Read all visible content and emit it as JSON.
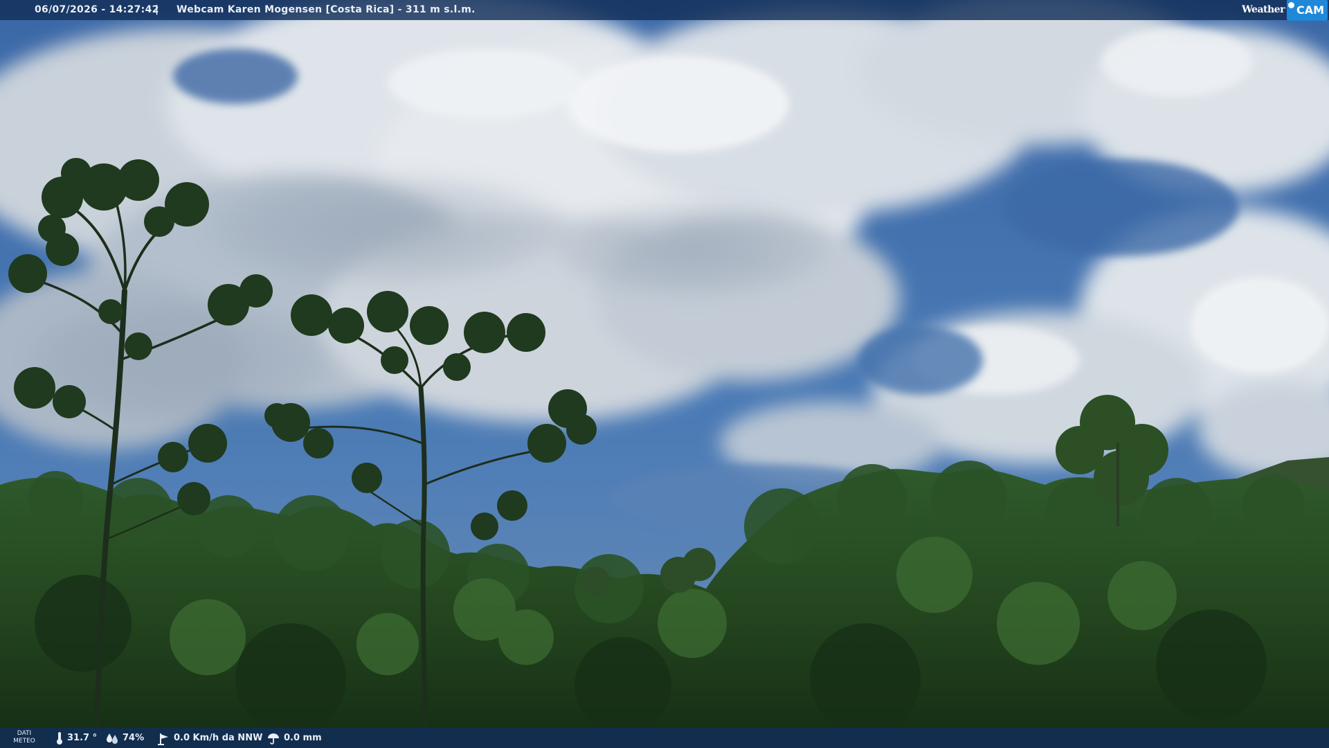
{
  "overlay": {
    "datetime": "06/07/2026 - 14:27:42",
    "separator": "|",
    "title": "Webcam Karen Mogensen [Costa Rica] - 311 m s.l.m.",
    "brand": {
      "weather": "Weather",
      "cam": "CAM"
    }
  },
  "weather": {
    "label_line1": "DATI",
    "label_line2": "METEO",
    "temperature": "31.7 °",
    "humidity": "74%",
    "wind": "0.0 Km/h da NNW",
    "rain": "0.0 mm"
  },
  "icons": {
    "temperature": "thermometer-icon",
    "humidity": "humidity-drop-icon",
    "wind": "wind-icon",
    "rain": "rain-umbrella-icon"
  },
  "colors": {
    "bar": "#122e58",
    "brand_accent": "#1f88d8",
    "sky": "#3f6ea8",
    "foliage": "#1f3b22"
  }
}
